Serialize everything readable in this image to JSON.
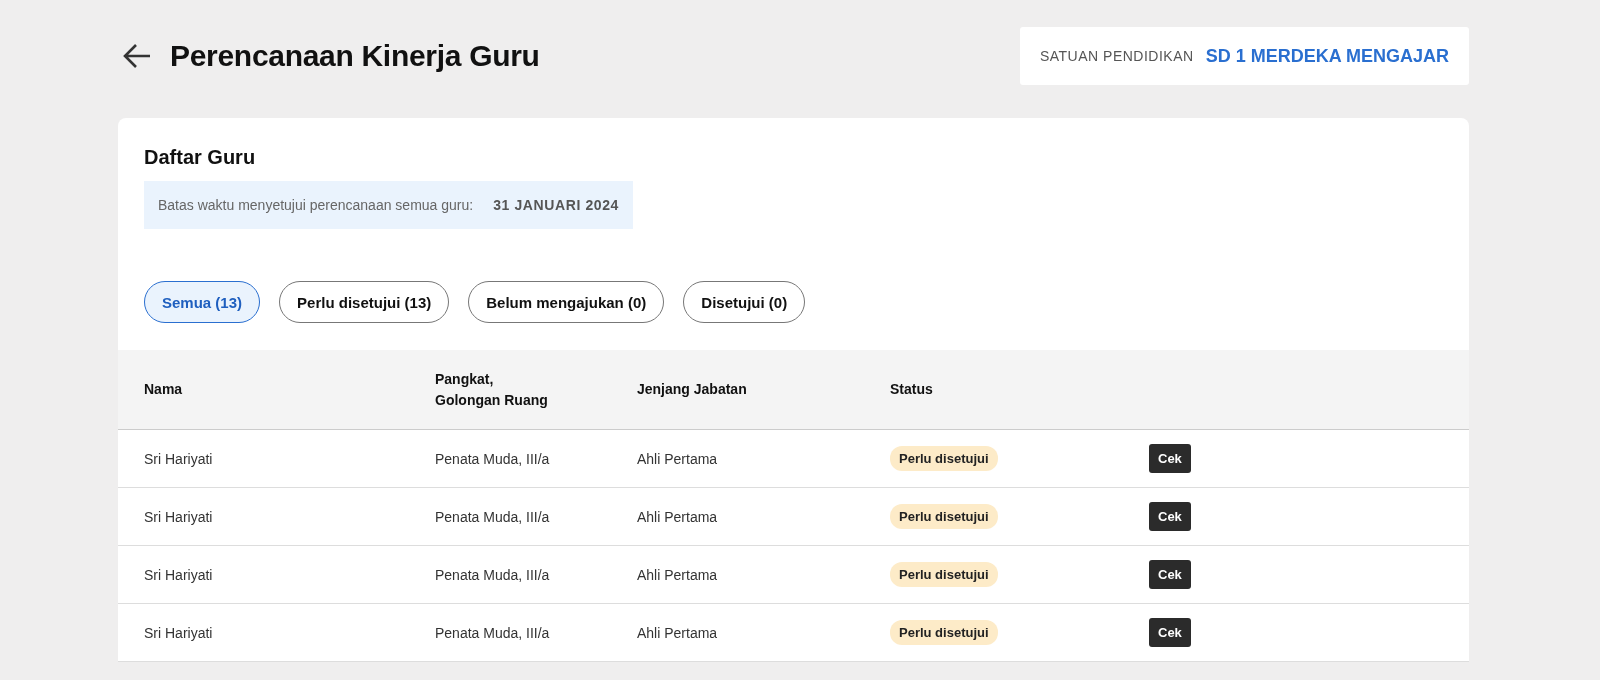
{
  "header": {
    "title": "Perencanaan Kinerja Guru",
    "school_label": "SATUAN PENDIDIKAN",
    "school_name": "SD 1 MERDEKA MENGAJAR"
  },
  "card": {
    "title": "Daftar Guru",
    "deadline_label": "Batas waktu menyetujui perencanaan semua guru:",
    "deadline_date": "31 JANUARI 2024"
  },
  "filters": [
    {
      "label": "Semua (13)",
      "selected": true
    },
    {
      "label": "Perlu disetujui (13)",
      "selected": false
    },
    {
      "label": "Belum mengajukan (0)",
      "selected": false
    },
    {
      "label": "Disetujui (0)",
      "selected": false
    }
  ],
  "table": {
    "columns": [
      "Nama",
      "Pangkat,\nGolongan Ruang",
      "Jenjang Jabatan",
      "Status"
    ],
    "rows": [
      {
        "nama": "Sri Hariyati",
        "pangkat": "Penata Muda, III/a",
        "jenjang": "Ahli Pertama",
        "status": "Perlu disetujui",
        "action": "Cek"
      },
      {
        "nama": "Sri Hariyati",
        "pangkat": "Penata Muda, III/a",
        "jenjang": "Ahli Pertama",
        "status": "Perlu disetujui",
        "action": "Cek"
      },
      {
        "nama": "Sri Hariyati",
        "pangkat": "Penata Muda, III/a",
        "jenjang": "Ahli Pertama",
        "status": "Perlu disetujui",
        "action": "Cek"
      },
      {
        "nama": "Sri Hariyati",
        "pangkat": "Penata Muda, III/a",
        "jenjang": "Ahli Pertama",
        "status": "Perlu disetujui",
        "action": "Cek"
      }
    ]
  }
}
